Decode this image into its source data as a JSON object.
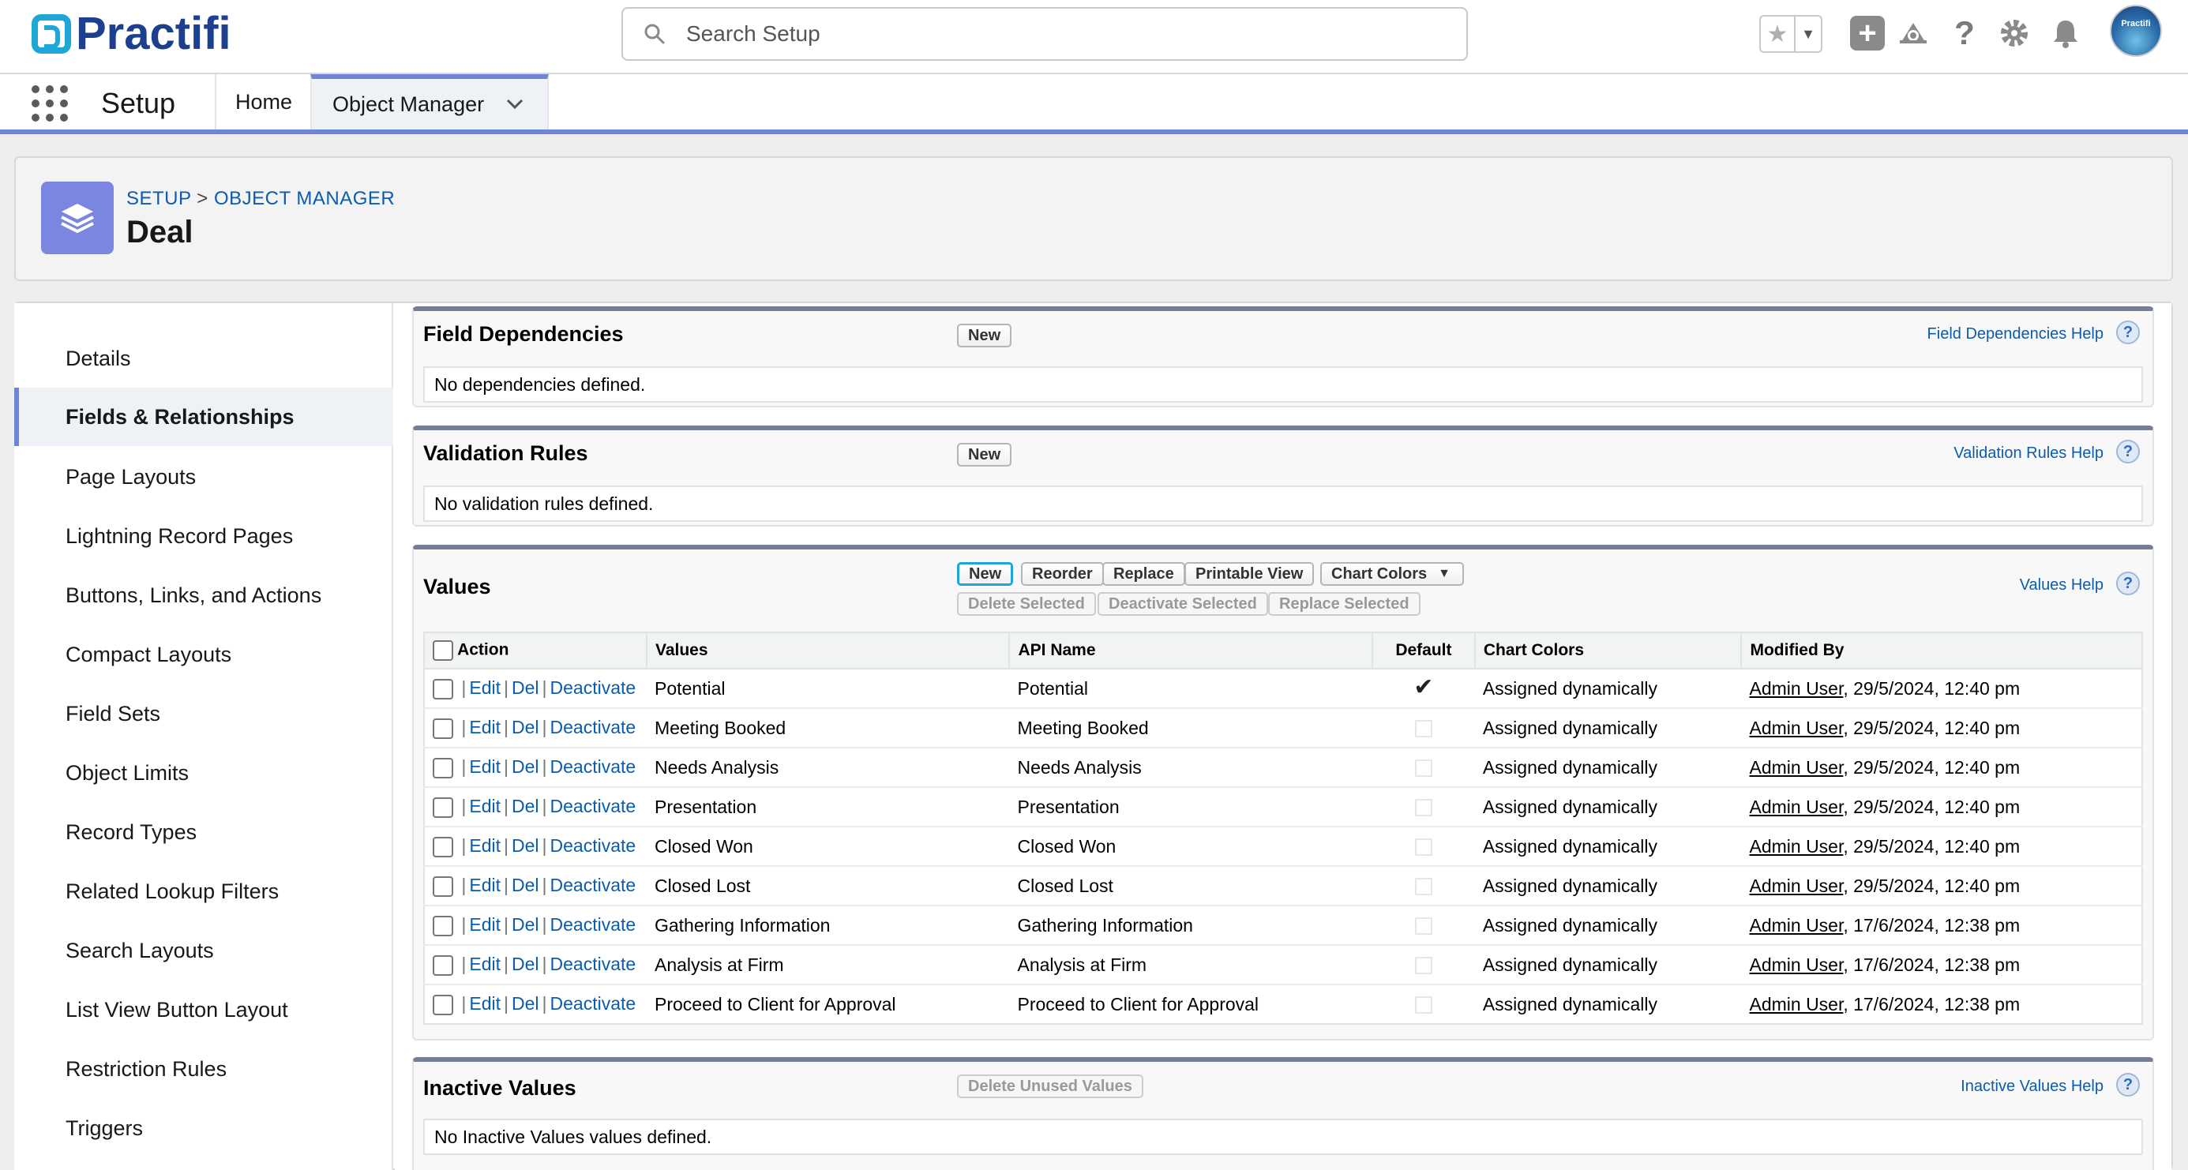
{
  "header": {
    "logo_text": "Practifi",
    "search_placeholder": "Search Setup",
    "avatar_text": "Practifi"
  },
  "nav": {
    "app_name": "Setup",
    "tabs": [
      {
        "label": "Home"
      },
      {
        "label": "Object Manager"
      }
    ]
  },
  "page_header": {
    "breadcrumb_setup": "SETUP",
    "breadcrumb_sep": ">",
    "breadcrumb_object_manager": "OBJECT MANAGER",
    "title": "Deal"
  },
  "sidebar": {
    "items": [
      {
        "label": "Details"
      },
      {
        "label": "Fields & Relationships"
      },
      {
        "label": "Page Layouts"
      },
      {
        "label": "Lightning Record Pages"
      },
      {
        "label": "Buttons, Links, and Actions"
      },
      {
        "label": "Compact Layouts"
      },
      {
        "label": "Field Sets"
      },
      {
        "label": "Object Limits"
      },
      {
        "label": "Record Types"
      },
      {
        "label": "Related Lookup Filters"
      },
      {
        "label": "Search Layouts"
      },
      {
        "label": "List View Button Layout"
      },
      {
        "label": "Restriction Rules"
      },
      {
        "label": "Triggers"
      }
    ]
  },
  "field_dependencies": {
    "title": "Field Dependencies",
    "new_label": "New",
    "help_label": "Field Dependencies Help",
    "empty_text": "No dependencies defined."
  },
  "validation_rules": {
    "title": "Validation Rules",
    "new_label": "New",
    "help_label": "Validation Rules Help",
    "empty_text": "No validation rules defined."
  },
  "values": {
    "title": "Values",
    "help_label": "Values Help",
    "buttons": {
      "new": "New",
      "reorder": "Reorder",
      "replace": "Replace",
      "printable_view": "Printable View",
      "chart_colors": "Chart Colors",
      "delete_selected": "Delete Selected",
      "deactivate_selected": "Deactivate Selected",
      "replace_selected": "Replace Selected"
    },
    "columns": {
      "action": "Action",
      "values": "Values",
      "api_name": "API Name",
      "default": "Default",
      "chart_colors": "Chart Colors",
      "modified_by": "Modified By"
    },
    "action_links": {
      "edit": "Edit",
      "del": "Del",
      "deactivate": "Deactivate",
      "sep": "|"
    },
    "rows": [
      {
        "value": "Potential",
        "api_name": "Potential",
        "chart_color": "Assigned dynamically",
        "user": "Admin User",
        "date": ", 29/5/2024, 12:40 pm"
      },
      {
        "value": "Meeting Booked",
        "api_name": "Meeting Booked",
        "chart_color": "Assigned dynamically",
        "user": "Admin User",
        "date": ", 29/5/2024, 12:40 pm"
      },
      {
        "value": "Needs Analysis",
        "api_name": "Needs Analysis",
        "chart_color": "Assigned dynamically",
        "user": "Admin User",
        "date": ", 29/5/2024, 12:40 pm"
      },
      {
        "value": "Presentation",
        "api_name": "Presentation",
        "chart_color": "Assigned dynamically",
        "user": "Admin User",
        "date": ", 29/5/2024, 12:40 pm"
      },
      {
        "value": "Closed Won",
        "api_name": "Closed Won",
        "chart_color": "Assigned dynamically",
        "user": "Admin User",
        "date": ", 29/5/2024, 12:40 pm"
      },
      {
        "value": "Closed Lost",
        "api_name": "Closed Lost",
        "chart_color": "Assigned dynamically",
        "user": "Admin User",
        "date": ", 29/5/2024, 12:40 pm"
      },
      {
        "value": "Gathering Information",
        "api_name": "Gathering Information",
        "chart_color": "Assigned dynamically",
        "user": "Admin User",
        "date": ", 17/6/2024, 12:38 pm"
      },
      {
        "value": "Analysis at Firm",
        "api_name": "Analysis at Firm",
        "chart_color": "Assigned dynamically",
        "user": "Admin User",
        "date": ", 17/6/2024, 12:38 pm"
      },
      {
        "value": "Proceed to Client for Approval",
        "api_name": "Proceed to Client for Approval",
        "chart_color": "Assigned dynamically",
        "user": "Admin User",
        "date": ", 17/6/2024, 12:38 pm"
      }
    ]
  },
  "inactive_values": {
    "title": "Inactive Values",
    "delete_unused_label": "Delete Unused Values",
    "help_label": "Inactive Values Help",
    "empty_text": "No Inactive Values values defined."
  },
  "colors": {
    "brand_blue": "#1d3f8f",
    "accent": "#6e86d9",
    "link": "#0b5cab"
  }
}
